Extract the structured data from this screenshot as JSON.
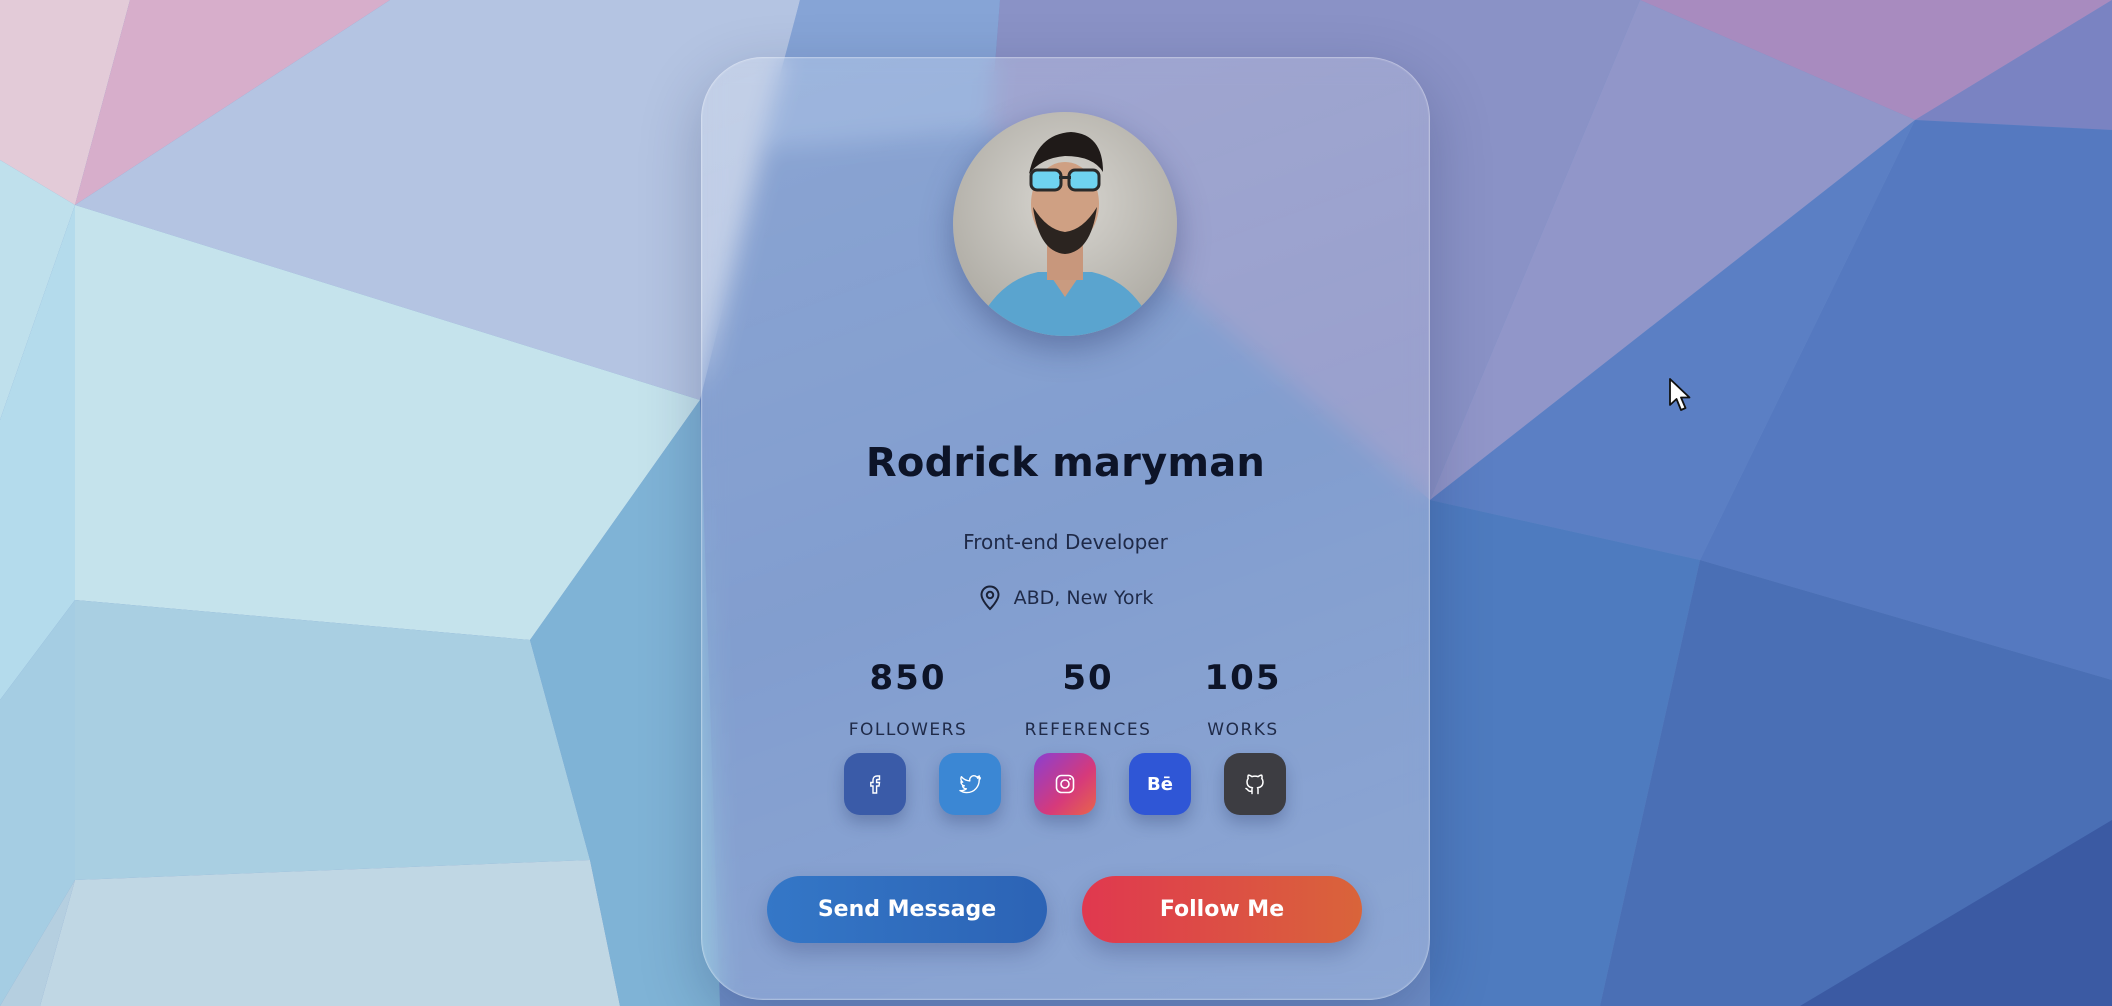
{
  "profile": {
    "name": "Rodrick maryman",
    "role": "Front-end Developer",
    "location": "ABD, New York",
    "avatar_icon": "avatar-photo"
  },
  "stats": [
    {
      "value": "850",
      "label": "FOLLOWERS"
    },
    {
      "value": "50",
      "label": "REFERENCES"
    },
    {
      "value": "105",
      "label": "WORKS"
    }
  ],
  "social": [
    {
      "icon": "facebook-icon",
      "color": "#3a5ba8"
    },
    {
      "icon": "twitter-icon",
      "color": "#3b87d4"
    },
    {
      "icon": "instagram-icon",
      "color": "#c13a7e"
    },
    {
      "icon": "behance-icon",
      "color": "#2f56d6",
      "text": "Bē"
    },
    {
      "icon": "github-icon",
      "color": "#3d3d42"
    }
  ],
  "buttons": {
    "send_message": "Send Message",
    "follow_me": "Follow Me"
  },
  "colors": {
    "send_button": "#2f6dc0",
    "follow_button": "#dc4b45",
    "text_dark": "#0d1428"
  }
}
